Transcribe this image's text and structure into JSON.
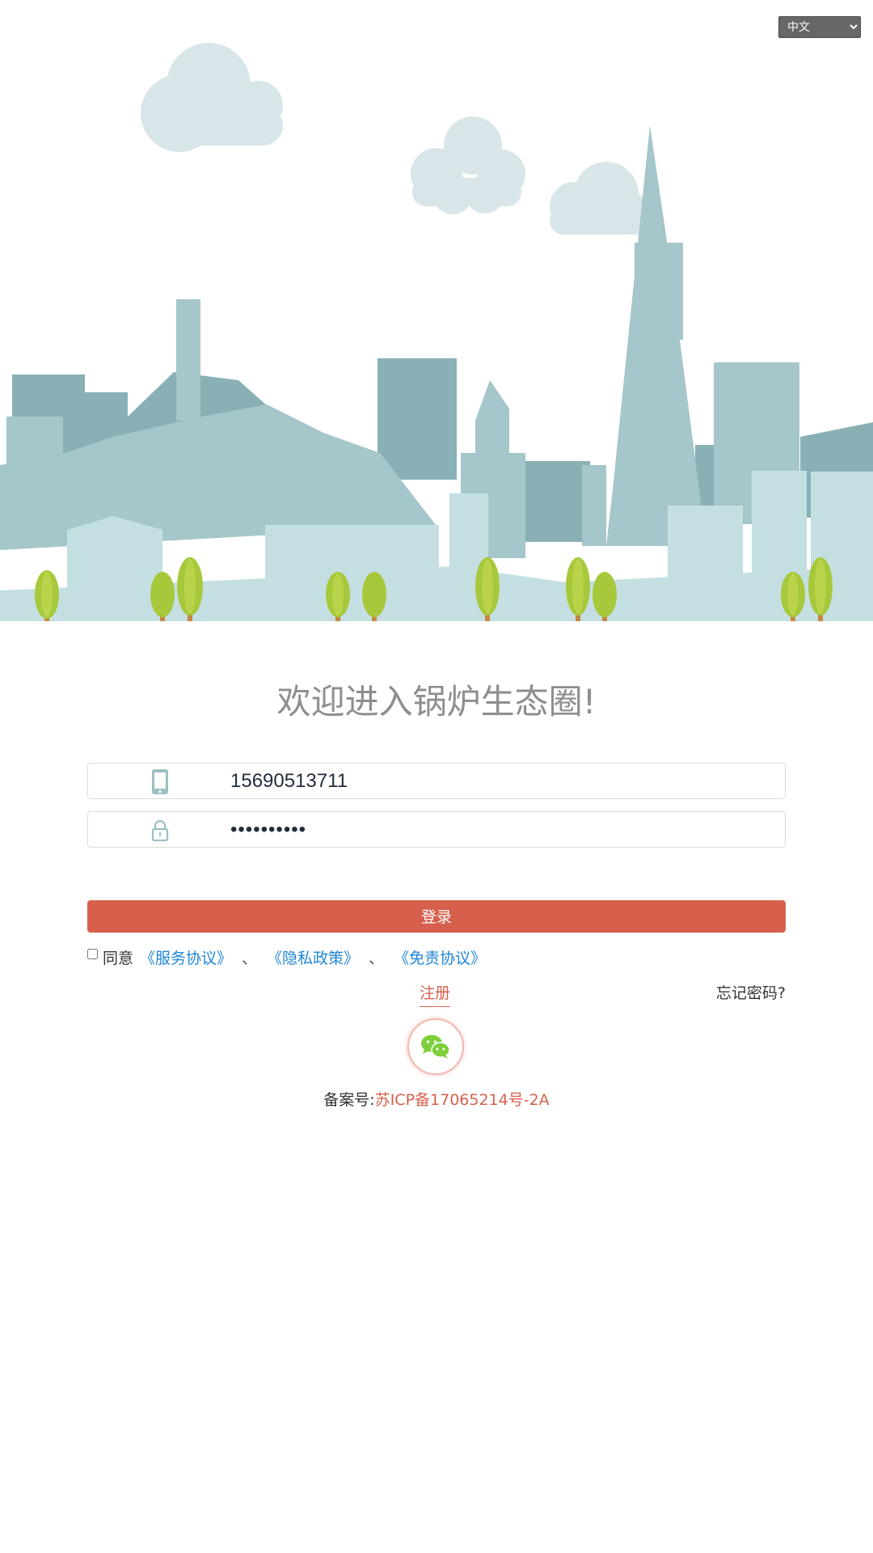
{
  "language_select": {
    "value": "中文",
    "options": [
      "中文"
    ]
  },
  "title": "欢迎进入锅炉生态圈!",
  "form": {
    "phone": {
      "value": "15690513711",
      "icon": "mobile-phone-icon"
    },
    "password": {
      "value": "••••••••••",
      "icon": "lock-icon"
    },
    "login_label": "登录"
  },
  "agreement": {
    "agree_text": "同意",
    "links": [
      "《服务协议》",
      "《隐私政策》",
      "《免责协议》"
    ],
    "separator": "、"
  },
  "register_label": "注册",
  "forgot_label": "忘记密码?",
  "wechat": {
    "icon": "wechat-icon"
  },
  "icp": {
    "label": "备案号:",
    "number": "苏ICP备17065214号-2A"
  },
  "colors": {
    "accent": "#d6604c",
    "link": "#1f85d6",
    "title": "#8e8e8e",
    "wechat_green": "#7ed03a"
  }
}
